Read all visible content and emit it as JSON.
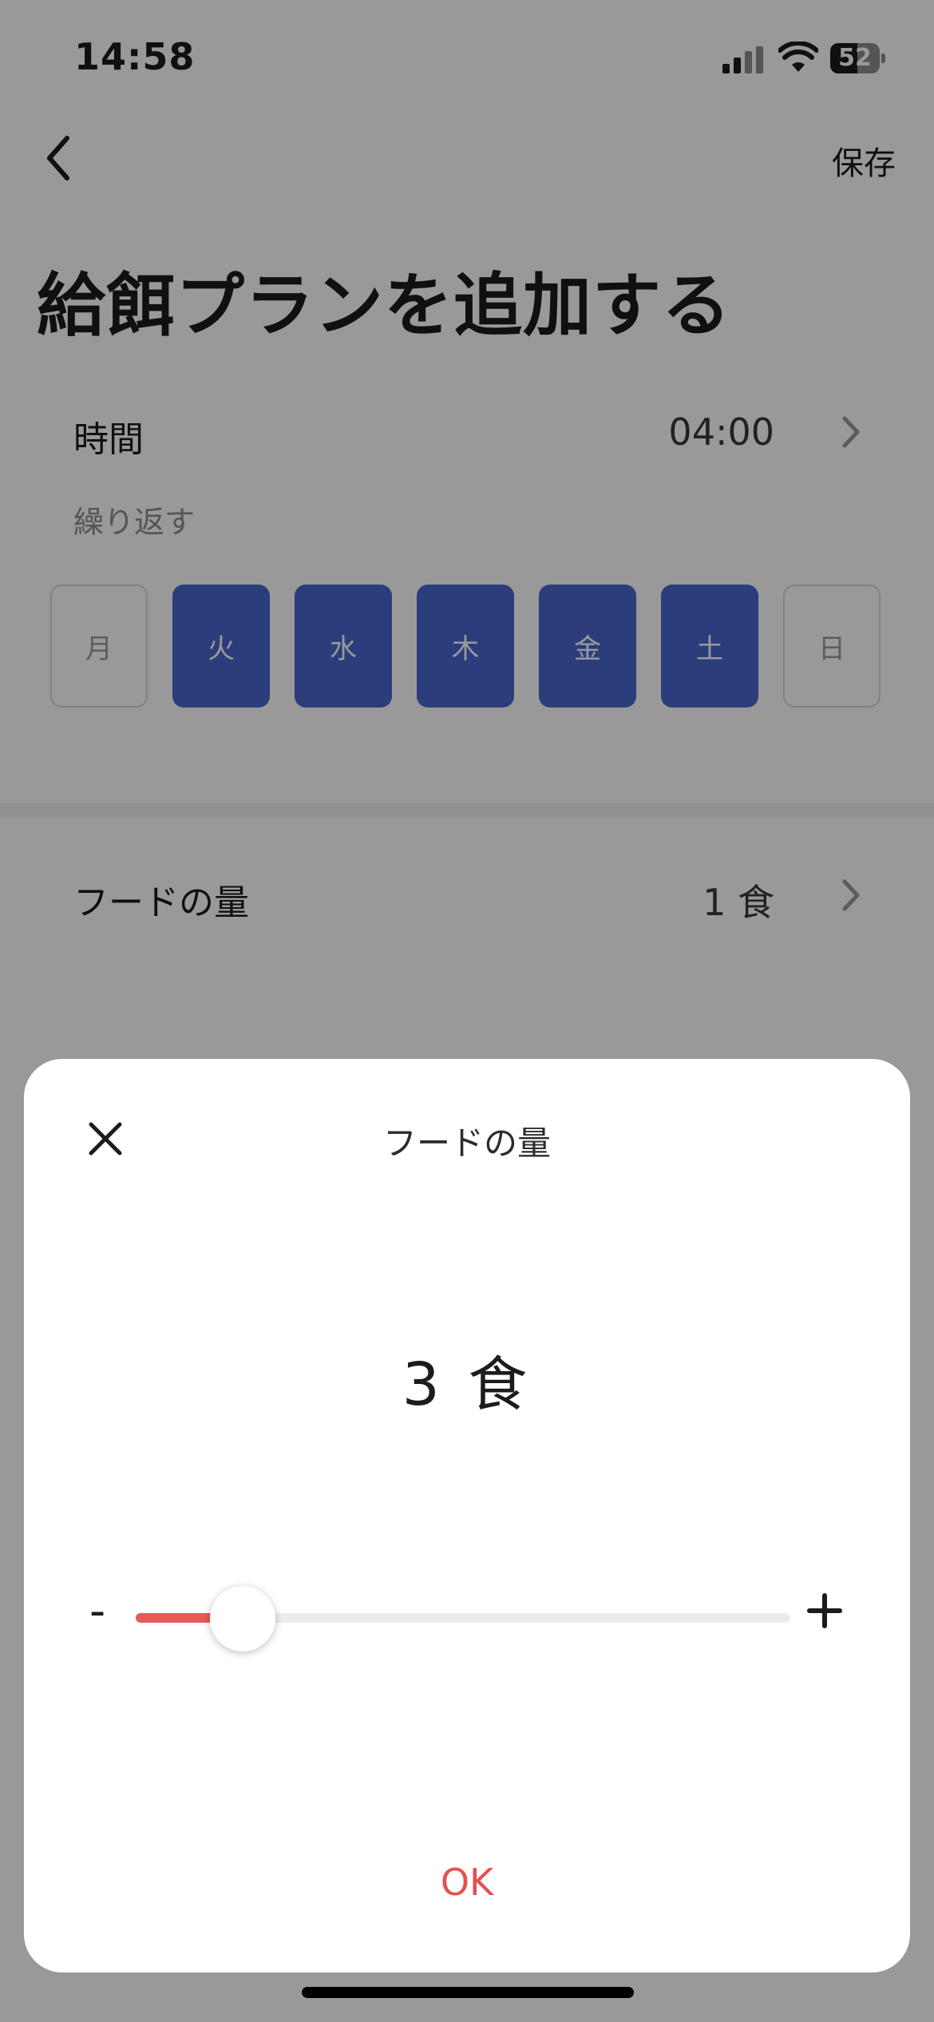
{
  "status_bar": {
    "time": "14:58",
    "battery": "52"
  },
  "header": {
    "save_label": "保存"
  },
  "page_title": "給餌プランを追加する",
  "time_row": {
    "label": "時間",
    "value": "04:00"
  },
  "repeat": {
    "label": "繰り返す",
    "days": [
      {
        "label": "月",
        "selected": false
      },
      {
        "label": "火",
        "selected": true
      },
      {
        "label": "水",
        "selected": true
      },
      {
        "label": "木",
        "selected": true
      },
      {
        "label": "金",
        "selected": true
      },
      {
        "label": "土",
        "selected": true
      },
      {
        "label": "日",
        "selected": false
      }
    ]
  },
  "food_row": {
    "label": "フードの量",
    "value": "1 食"
  },
  "sheet": {
    "title": "フードの量",
    "amount": "3 食",
    "minus_label": "-",
    "slider": {
      "value": 3,
      "min": 1,
      "max": 20
    },
    "ok_label": "OK"
  },
  "colors": {
    "accent": "#4a67cf",
    "danger": "#e5504f",
    "slider_fill": "#e65a5a"
  }
}
